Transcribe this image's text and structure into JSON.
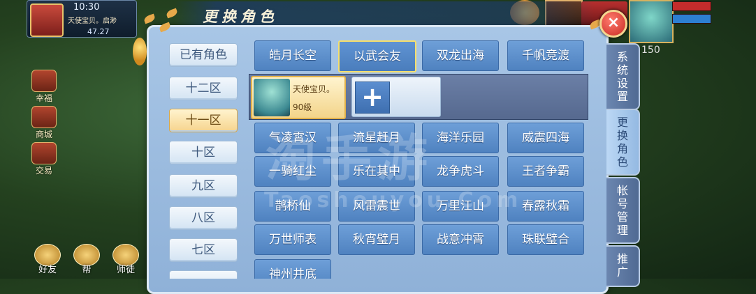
{
  "hud": {
    "time": "10:30",
    "player_name": "天使宝贝。启渺",
    "coords": "47.27",
    "level": "150",
    "side_menu": [
      "幸福",
      "商城",
      "交易"
    ],
    "bottom_buttons": [
      "好友",
      "帮",
      "师徒"
    ]
  },
  "dialog": {
    "title": "更换角色",
    "close_label": "×"
  },
  "servers": [
    "已有角色",
    "十二区",
    "十一区",
    "十区",
    "九区",
    "八区",
    "七区"
  ],
  "selected_server": "十一区",
  "grid_top": [
    "皓月长空",
    "以武会友",
    "双龙出海",
    "千帆竞渡"
  ],
  "selected_cell": "以武会友",
  "character": {
    "name": "天使宝贝。",
    "level": "90级"
  },
  "add_label": "+",
  "grid_rows": [
    [
      "气凌霄汉",
      "流星赶月",
      "海洋乐园",
      "威震四海"
    ],
    [
      "一骑红尘",
      "乐在其中",
      "龙争虎斗",
      "王者争霸"
    ],
    [
      "鹊桥仙",
      "风雷震世",
      "万里江山",
      "春露秋霜"
    ],
    [
      "万世师表",
      "秋宵璧月",
      "战意冲霄",
      "珠联璧合"
    ],
    [
      "神州井底"
    ]
  ],
  "tabs": [
    "系统设置",
    "更换角色",
    "帐号管理",
    "推广"
  ],
  "active_tab": "更换角色",
  "watermark": {
    "main": "淘手游",
    "sub": "Taoshouyou.Com"
  },
  "colors": {
    "panel": "#8fb1d8",
    "cell": "#4f82c0",
    "selected_border": "#f6df6c",
    "active_server": "#f6d48c"
  }
}
